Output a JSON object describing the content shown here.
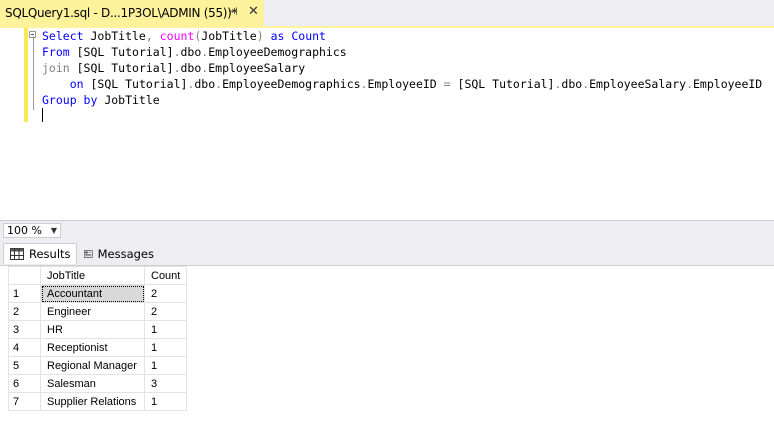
{
  "tab": {
    "title": "SQLQuery1.sql - D...1P3OL\\ADMIN (55))*",
    "pin_glyph": "⊣",
    "close_glyph": "✕"
  },
  "editor": {
    "lines": [
      [
        {
          "t": "Select",
          "c": "kw"
        },
        {
          "t": " JobTitle"
        },
        {
          "t": ",",
          "c": "op"
        },
        {
          "t": " "
        },
        {
          "t": "count",
          "c": "fn"
        },
        {
          "t": "(",
          "c": "op"
        },
        {
          "t": "JobTitle"
        },
        {
          "t": ")",
          "c": "op"
        },
        {
          "t": " "
        },
        {
          "t": "as",
          "c": "kw"
        },
        {
          "t": " Count",
          "c": "kw"
        }
      ],
      [
        {
          "t": "From",
          "c": "kw"
        },
        {
          "t": " [SQL Tutorial]"
        },
        {
          "t": ".",
          "c": "op"
        },
        {
          "t": "dbo"
        },
        {
          "t": ".",
          "c": "op"
        },
        {
          "t": "EmployeeDemographics"
        }
      ],
      [
        {
          "t": "join",
          "c": "op"
        },
        {
          "t": " [SQL Tutorial]"
        },
        {
          "t": ".",
          "c": "op"
        },
        {
          "t": "dbo"
        },
        {
          "t": ".",
          "c": "op"
        },
        {
          "t": "EmployeeSalary"
        }
      ],
      [
        {
          "t": "    "
        },
        {
          "t": "on",
          "c": "kw"
        },
        {
          "t": " [SQL Tutorial]"
        },
        {
          "t": ".",
          "c": "op"
        },
        {
          "t": "dbo"
        },
        {
          "t": ".",
          "c": "op"
        },
        {
          "t": "EmployeeDemographics"
        },
        {
          "t": ".",
          "c": "op"
        },
        {
          "t": "EmployeeID "
        },
        {
          "t": "=",
          "c": "op"
        },
        {
          "t": " [SQL Tutorial]"
        },
        {
          "t": ".",
          "c": "op"
        },
        {
          "t": "dbo"
        },
        {
          "t": ".",
          "c": "op"
        },
        {
          "t": "EmployeeSalary"
        },
        {
          "t": ".",
          "c": "op"
        },
        {
          "t": "EmployeeID"
        }
      ],
      [
        {
          "t": "Group by",
          "c": "kw"
        },
        {
          "t": " JobTitle"
        }
      ]
    ]
  },
  "zoom": {
    "value": "100 %",
    "arrow": "▼"
  },
  "results_tabs": {
    "results": "Results",
    "messages": "Messages"
  },
  "grid": {
    "columns": [
      "JobTitle",
      "Count"
    ],
    "rows": [
      {
        "n": "1",
        "job": "Accountant",
        "count": "2"
      },
      {
        "n": "2",
        "job": "Engineer",
        "count": "2"
      },
      {
        "n": "3",
        "job": "HR",
        "count": "1"
      },
      {
        "n": "4",
        "job": "Receptionist",
        "count": "1"
      },
      {
        "n": "5",
        "job": "Regional Manager",
        "count": "1"
      },
      {
        "n": "6",
        "job": "Salesman",
        "count": "3"
      },
      {
        "n": "7",
        "job": "Supplier Relations",
        "count": "1"
      }
    ]
  },
  "colors": {
    "tab_active": "#fff29d",
    "keyword": "#0000ff",
    "function": "#ff00ff",
    "operator": "#808080"
  }
}
